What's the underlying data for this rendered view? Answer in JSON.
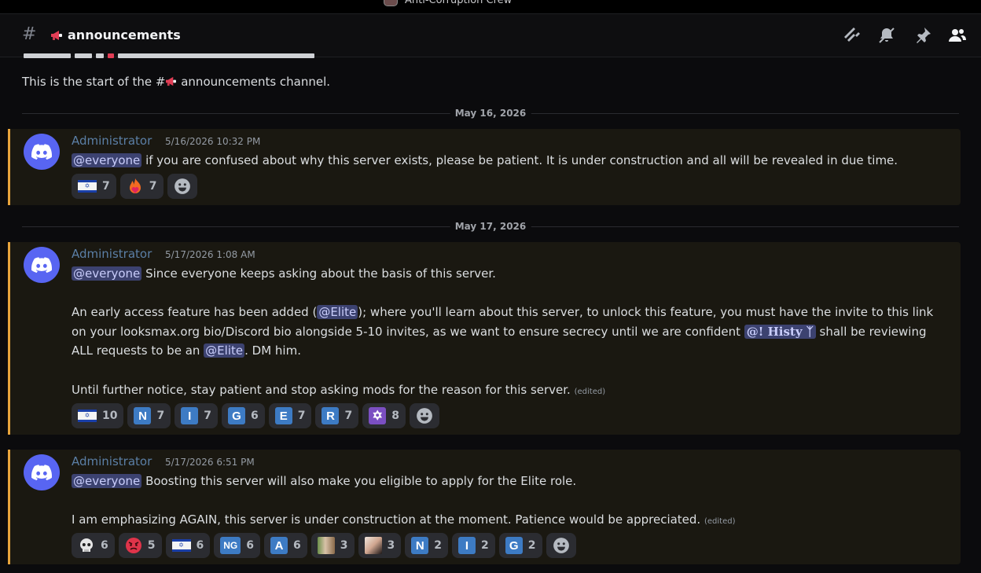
{
  "server": {
    "name": "Anti-Corruption Crew"
  },
  "header": {
    "channel_name": "announcements",
    "icons": [
      "threads-icon",
      "mute-icon",
      "pin-icon",
      "members-icon"
    ]
  },
  "chat": {
    "start_text": "This is the start of the #",
    "start_text_tail": "announcements channel."
  },
  "dividers": [
    "May 16, 2026",
    "May 17, 2026"
  ],
  "messages": [
    {
      "author": "Administrator",
      "time": "5/16/2026 10:32 PM",
      "mention": "@everyone",
      "text": "if you are confused about why this server exists, please be patient. It is under construction and all will be revealed in due time.",
      "reactions": [
        {
          "emoji": "flag-israel",
          "count": "7"
        },
        {
          "emoji": "fire-heart",
          "count": "7"
        }
      ]
    },
    {
      "author": "Administrator",
      "time": "5/17/2026 1:08 AM",
      "mention": "@everyone",
      "line1": "Since everyone keeps asking about the basis of this server.",
      "p2_a": "An early access feature has been added (",
      "role_elite": "@Elite",
      "p2_b": "); where you'll learn about this server, to unlock this feature, you must have the invite to this link on your looksmax.org bio/Discord bio alongside 5-10 invites, as we want to ensure secrecy until we are confident",
      "user_mention": "@! Histy ᛉ",
      "p2_c": "shall be reviewing ALL requests to be an",
      "p2_d": ". DM him.",
      "p3": "Until further notice, stay patient and stop asking mods for the reason for this server.",
      "edited": "(edited)",
      "reactions": [
        {
          "emoji": "flag-israel",
          "count": "10"
        },
        {
          "letter": "N",
          "count": "7"
        },
        {
          "letter": "I",
          "count": "7"
        },
        {
          "letter": "G",
          "count": "6"
        },
        {
          "letter": "E",
          "count": "7"
        },
        {
          "letter": "R",
          "count": "7"
        },
        {
          "emoji": "star-of-david",
          "count": "8"
        }
      ]
    },
    {
      "author": "Administrator",
      "time": "5/17/2026 6:51 PM",
      "mention": "@everyone",
      "line1": "Boosting this server will also make you eligible to apply for the Elite role.",
      "p2": "I am emphasizing AGAIN, this server is under construction at the moment. Patience would be appreciated.",
      "edited": "(edited)",
      "reactions": [
        {
          "emoji": "skull",
          "count": "6"
        },
        {
          "emoji": "angry-face",
          "count": "5"
        },
        {
          "emoji": "flag-israel",
          "count": "6"
        },
        {
          "letter": "NG",
          "count": "6"
        },
        {
          "letter": "A",
          "count": "6"
        },
        {
          "emoji": "custom-photo-1",
          "count": "3"
        },
        {
          "emoji": "custom-photo-2",
          "count": "3"
        },
        {
          "letter": "N",
          "count": "2"
        },
        {
          "letter": "I",
          "count": "2"
        },
        {
          "letter": "G",
          "count": "2"
        }
      ]
    }
  ],
  "colors": {
    "accent_border": "#e8a53c",
    "message_bg": "#1a1811",
    "blurple": "#5865f2",
    "author": "#5b7fa6",
    "mention_bg": "#3c4270"
  }
}
